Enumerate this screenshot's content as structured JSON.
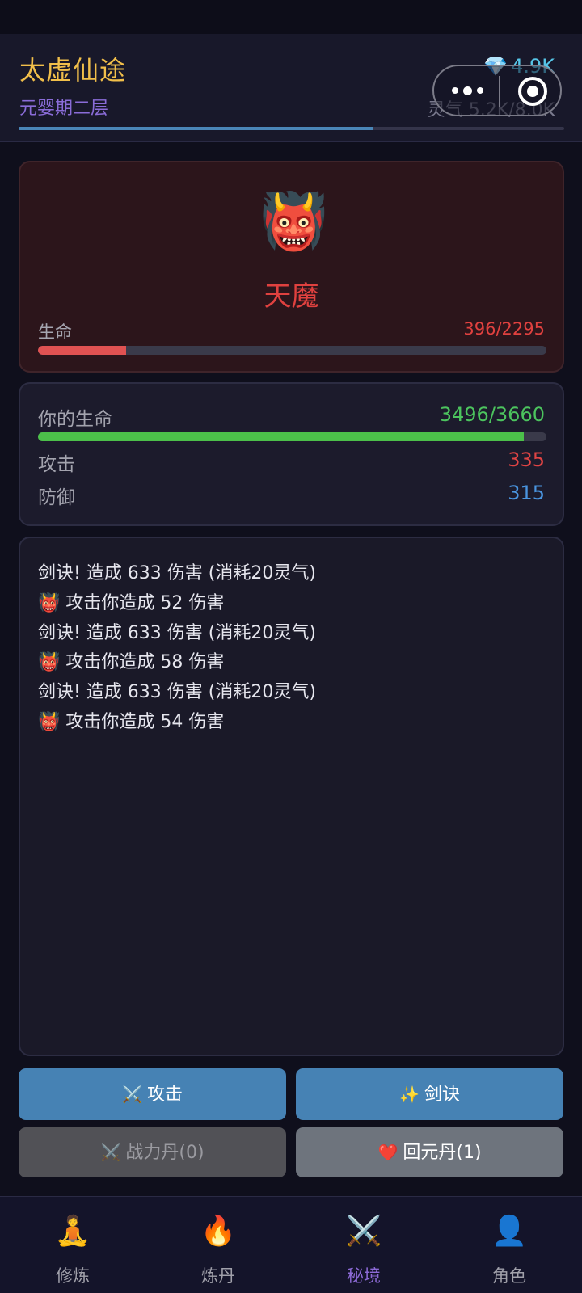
{
  "header": {
    "app_title": "太虚仙途",
    "realm": "元婴期二层",
    "gems": "4.9K",
    "qi": "灵气 5.2K/8.0K",
    "qi_progress": 0.65,
    "gem_icon": "💎"
  },
  "enemy": {
    "avatar": "👹",
    "name": "天魔",
    "hp_label": "生命",
    "hp_value": "396/2295",
    "hp_ratio": 0.1725
  },
  "player": {
    "hp_label": "你的生命",
    "hp_value": "3496/3660",
    "hp_ratio": 0.955,
    "atk_label": "攻击",
    "atk_value": "335",
    "def_label": "防御",
    "def_value": "315"
  },
  "battle_log": [
    "剑诀! 造成 633 伤害 (消耗20灵气)",
    "👹 攻击你造成 52 伤害",
    "剑诀! 造成 633 伤害 (消耗20灵气)",
    "👹 攻击你造成 58 伤害",
    "剑诀! 造成 633 伤害 (消耗20灵气)",
    "👹 攻击你造成 54 伤害"
  ],
  "actions": {
    "attack_icon": "⚔️",
    "attack_label": "攻击",
    "sword_icon": "✨",
    "sword_label": "剑诀",
    "power_pill_icon": "⚔️",
    "power_pill_label": "战力丹(0)",
    "recover_pill_icon": "❤️",
    "recover_pill_label": "回元丹(1)"
  },
  "nav": [
    {
      "icon": "🧘",
      "label": "修炼"
    },
    {
      "icon": "🔥",
      "label": "炼丹"
    },
    {
      "icon": "⚔️",
      "label": "秘境"
    },
    {
      "icon": "👤",
      "label": "角色"
    }
  ],
  "nav_active_index": 2
}
